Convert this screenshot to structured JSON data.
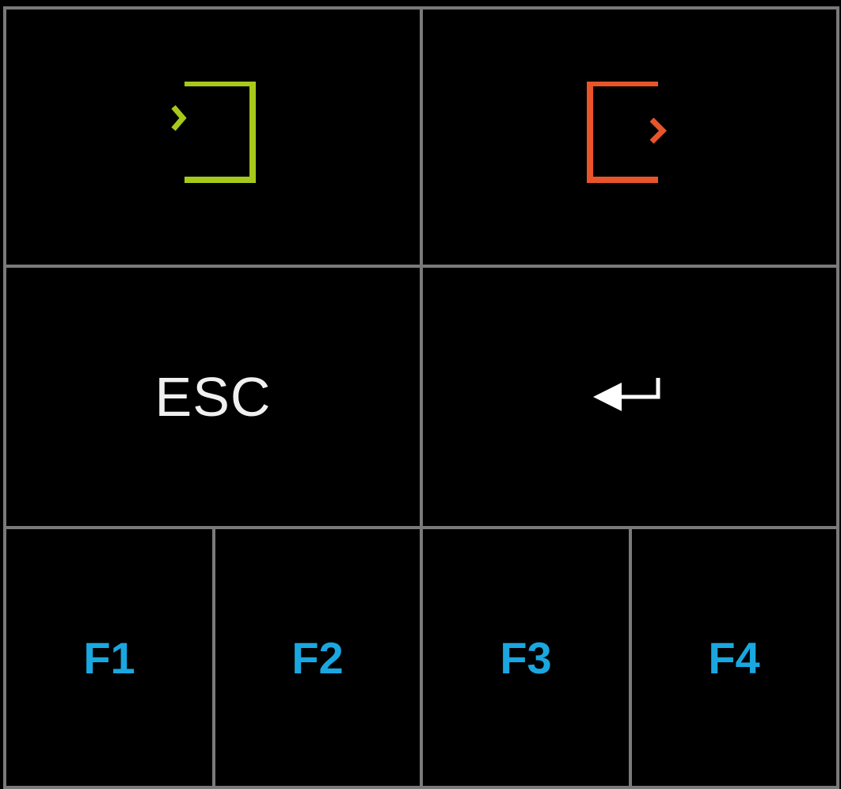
{
  "keypad": {
    "top_row": [
      {
        "icon": "login-icon",
        "color": "#a6c91a"
      },
      {
        "icon": "logout-icon",
        "color": "#e8552a"
      }
    ],
    "middle_row": [
      {
        "label": "ESC"
      },
      {
        "icon": "enter-icon",
        "color": "#ffffff"
      }
    ],
    "function_keys": [
      {
        "label": "F1"
      },
      {
        "label": "F2"
      },
      {
        "label": "F3"
      },
      {
        "label": "F4"
      }
    ]
  },
  "colors": {
    "background": "#000000",
    "grid_lines": "#7a7a7a",
    "function_key_text": "#1aa7e0",
    "esc_text": "#f0f0f0"
  }
}
